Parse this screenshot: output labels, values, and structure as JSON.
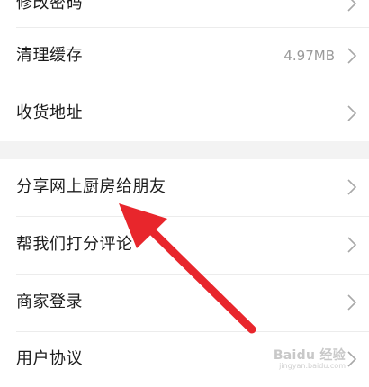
{
  "settings": {
    "items": [
      {
        "label": "修改密码",
        "value": ""
      },
      {
        "label": "清理缓存",
        "value": "4.97MB"
      },
      {
        "label": "收货地址",
        "value": ""
      },
      {
        "label": "分享网上厨房给朋友",
        "value": ""
      },
      {
        "label": "帮我们打分评论",
        "value": ""
      },
      {
        "label": "商家登录",
        "value": ""
      },
      {
        "label": "用户协议",
        "value": ""
      }
    ]
  },
  "overlay": {
    "arrow_color": "#e8262c"
  },
  "watermark": {
    "logo": "Baidu 经验",
    "url": "jingyan.baidu.com"
  },
  "icons": {
    "chevron": "chevron-right-icon"
  }
}
